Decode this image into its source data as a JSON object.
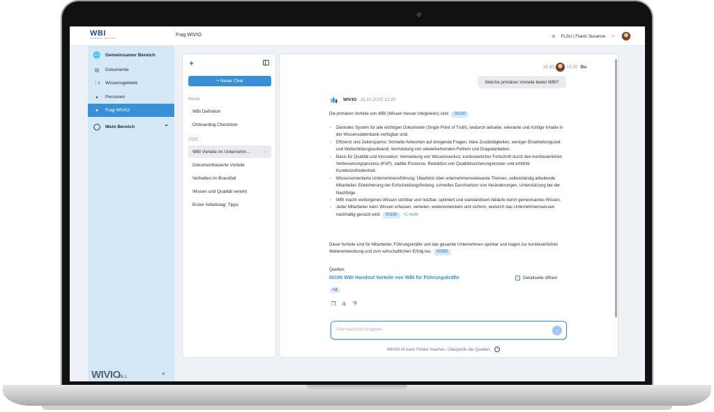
{
  "topbar": {
    "logo_main": "WBI",
    "logo_sub": "KNOWLEDGE SOLUTIONS",
    "title": "Frag WIVIO",
    "user": "FLSU | Flantz Susanne",
    "chevron": "⌄",
    "list_icon": "≡"
  },
  "sidebar": {
    "items": [
      {
        "label": "Gemeinsamer Bereich",
        "icon": "globe-icon",
        "glyph": "🌐"
      },
      {
        "label": "Dokumente",
        "icon": "documents-icon",
        "glyph": "▤"
      },
      {
        "label": "Wissensgebiete",
        "icon": "knowledge-areas-icon",
        "glyph": "⋮≡"
      },
      {
        "label": "Personen",
        "icon": "person-icon",
        "glyph": "▲"
      },
      {
        "label": "Frag WIVIO",
        "icon": "sparkle-icon",
        "glyph": "✦"
      },
      {
        "label": "Mein Bereich",
        "icon": "user-outline-icon",
        "glyph": "◯"
      }
    ],
    "chevron": "⌄",
    "brand": "WIVIO",
    "version": "26.1",
    "collapse": "«"
  },
  "history": {
    "new_chat": "+ Neuer Chat",
    "groups": [
      {
        "label": "Heute",
        "items": [
          "WBI Definition",
          "Onboarding Checkliste"
        ]
      },
      {
        "label": "2025",
        "items": [
          "WBI Vorteile im Unternehm…",
          "Dokumentbasierte Vorteile",
          "Verhalten im Brandfall",
          "Wissen und Qualität vereint",
          "Erster Arbeitstag: Tipps"
        ]
      }
    ],
    "dots": "···"
  },
  "chat": {
    "user_time": "15.10.2025 13:20",
    "user_name": "Du",
    "user_message": "Welche primären Vorteile bietet WBI?",
    "ai_name": "WIVIO",
    "ai_time": "15.10.2025 13:20",
    "intro": "Die primären Vorteile von WBI (Wissen besser integrieren) sind:",
    "intro_chip": "00190",
    "bullets": [
      "Zentrales System für alle wichtigen Dokumente (Single Point of Truth), wodurch aktuelle, relevante und richtige Inhalte in der Wissensdatenbank verfügbar sind.",
      "Effizienz und Zeitersparnis: Schnelle Antworten auf dringende Fragen, klare Zuständigkeiten, weniger Einarbeitungszeit und Weiterbildungsaufwand, Vermeidung von wiederkehrenden Fehlern und Doppelarbeiten.",
      "Basis für Qualität und Innovation: Vermeidung von Wissensverlust, kontinuierlicher Fortschritt durch den kontinuierlichen Verbesserungsprozess (KVP), stabile Prozesse, Reduktion von Qualitätssicherungskosten und erhöhte Kundenzufriedenheit.",
      "Wissensorientierte Unternehmensführung: Überblick über unternehmensrelevante Themen, selbstständig arbeitende Mitarbeiter, Erleichterung der Entscheidungsfindung, schnelles Durchsetzen von Veränderungen, Unterstützung bei der Nachfolge.",
      "WBI macht verborgenes Wissen sichtbar und nutzbar, optimiert und standardisiert Abläufe durch gemeinsames Wissen.",
      "Jeder Mitarbeiter kann Wissen erfassen, verteilen, weiterentwickeln und sichern, wodurch das Unternehmenswissen nachhaltig genutzt wird."
    ],
    "last_bullet_chip": "00190",
    "last_bullet_more": "+1 mehr",
    "closing": "Diese Vorteile sind für Mitarbeiter, Führungskräfte und das gesamte Unternehmen spürbar und tragen zur kontinuierlichen Weiterentwicklung und zum wirtschaftlichen Erfolg bei.",
    "closing_chip": "00500",
    "sources_label": "Quellen:",
    "source_link": "00190 WBI Handout Vorteile von WBI für Führungskräfte",
    "detail_link": "Detailseite öffnen",
    "more_sources": "+2",
    "input_placeholder": "Eine Nachricht eingeben",
    "send_glyph": "↑",
    "disclaimer": "WIVIO AI kann Fehler machen. Überprüfe die Quellen.",
    "copy_glyph": "❐",
    "like_glyph": "👍",
    "dislike_glyph": "👎",
    "info_glyph": "i"
  },
  "colors": {
    "accent": "#3a90d6",
    "sidebar_bg": "#d5e8f7",
    "brand_dark": "#1f4e8c"
  }
}
